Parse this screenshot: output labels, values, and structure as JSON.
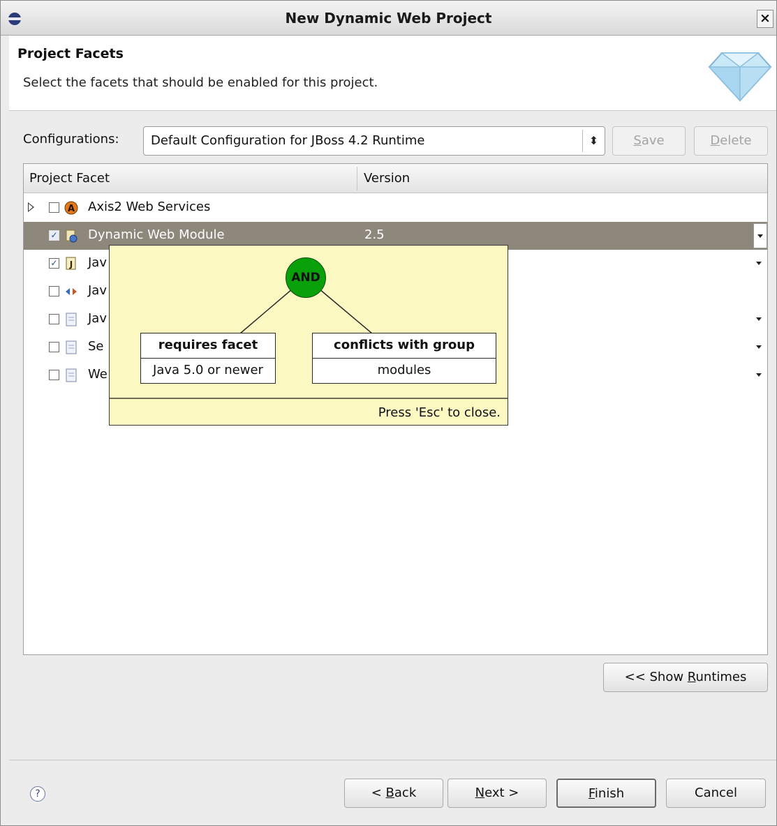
{
  "window": {
    "title": "New Dynamic Web Project",
    "close_label": "×"
  },
  "header": {
    "title": "Project Facets",
    "description": "Select the facets that should be enabled for this project."
  },
  "config": {
    "label": "Configurations:",
    "selected": "Default Configuration for JBoss 4.2 Runtime",
    "save_label": "ave",
    "save_mnemonic": "S",
    "delete_label": "elete",
    "delete_mnemonic": "D"
  },
  "table": {
    "columns": [
      "Project Facet",
      "Version"
    ],
    "rows": [
      {
        "label": "Axis2 Web Services",
        "version": "",
        "checked": false,
        "icon": "axis2-icon",
        "selected": false,
        "expandable": true
      },
      {
        "label": "Dynamic Web Module",
        "version": "2.5",
        "checked": true,
        "icon": "web-module-icon",
        "selected": true,
        "expandable": false
      },
      {
        "label": "Jav",
        "version": "",
        "checked": true,
        "icon": "java-icon",
        "selected": false,
        "expandable": false
      },
      {
        "label": "Jav",
        "version": "",
        "checked": false,
        "icon": "javascript-icon",
        "selected": false,
        "expandable": false
      },
      {
        "label": "Jav",
        "version": "",
        "checked": false,
        "icon": "document-icon",
        "selected": false,
        "expandable": false
      },
      {
        "label": "Se",
        "version": "",
        "checked": false,
        "icon": "document-icon",
        "selected": false,
        "expandable": false
      },
      {
        "label": "We",
        "version": "",
        "checked": false,
        "icon": "document-icon",
        "selected": false,
        "expandable": false
      }
    ]
  },
  "tooltip": {
    "operator": "AND",
    "requires": {
      "title": "requires facet",
      "value": "Java 5.0 or newer"
    },
    "conflicts": {
      "title": "conflicts with group",
      "value": "modules"
    },
    "hint": "Press 'Esc' to close."
  },
  "runtimes_button": {
    "prefix": "<< Show ",
    "mnemonic": "R",
    "rest": "untimes"
  },
  "footer": {
    "help_label": "?",
    "back": {
      "prefix": "< ",
      "mnemonic": "B",
      "rest": "ack"
    },
    "next": {
      "mnemonic": "N",
      "rest": "ext >"
    },
    "finish": {
      "mnemonic": "F",
      "rest": "inish"
    },
    "cancel_label": "Cancel"
  },
  "colors": {
    "selection": "#8d877c",
    "tooltip_bg": "#fbf8c2",
    "and_node": "#0aa00a"
  }
}
